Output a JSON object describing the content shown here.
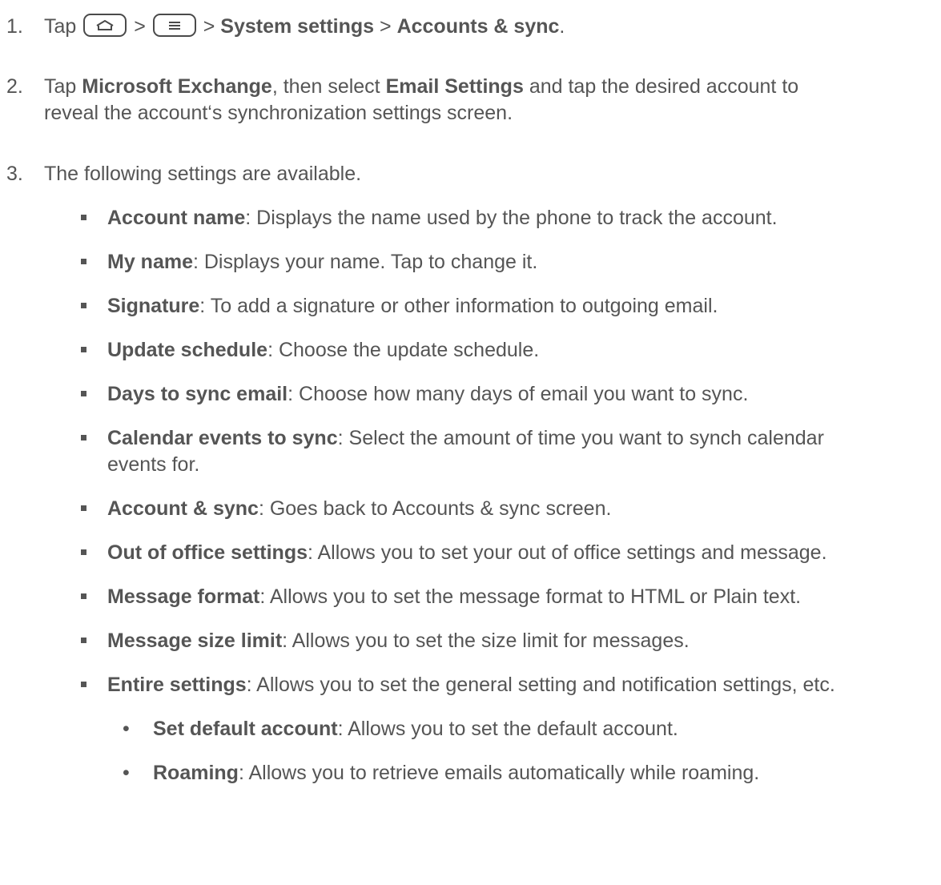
{
  "steps": [
    {
      "num": "1.",
      "tap": "Tap",
      "sep1": ">",
      "sep2": ">",
      "system_settings": "System settings",
      "sep3": ">",
      "accounts_sync": "Accounts & sync",
      "end": ".",
      "keys": [
        "home-icon",
        "menu-icon"
      ]
    },
    {
      "num": "2.",
      "tap": "Tap",
      "microsoft_exchange": "Microsoft Exchange",
      "then_select": ", then select",
      "email_settings": "Email Settings",
      "rest_line1": "and tap the desired account to",
      "line2": "reveal the account‘s synchronization settings screen."
    },
    {
      "num": "3.",
      "text": "The following settings are available."
    }
  ],
  "settings": [
    {
      "term": "Account name",
      "desc": ": Displays the name used by the phone to track the account."
    },
    {
      "term": "My name",
      "desc": ": Displays your name. Tap to change it."
    },
    {
      "term": "Signature",
      "desc": ": To add a signature or other information to outgoing email."
    },
    {
      "term": "Update schedule",
      "desc": ": Choose the update schedule."
    },
    {
      "term": "Days to sync email",
      "desc": ": Choose how many days of email you want to sync."
    },
    {
      "term": "Calendar events to sync",
      "desc": ": Select the amount of time you want to synch calendar",
      "desc2": "events for."
    },
    {
      "term": "Account & sync",
      "desc": ": Goes back to Accounts & sync screen."
    },
    {
      "term": "Out of office settings",
      "desc": ": Allows you to set your out of office settings and message."
    },
    {
      "term": "Message format",
      "desc": ": Allows you to set the message format to HTML or Plain text."
    },
    {
      "term": "Message size limit",
      "desc": ": Allows you to set the size limit for messages."
    },
    {
      "term": "Entire settings",
      "desc": ": Allows you to set the general setting and notification settings, etc."
    }
  ],
  "entire_settings_sub": [
    {
      "mark": "•",
      "term": "Set default account",
      "desc": ": Allows you to set the default account."
    },
    {
      "mark": "•",
      "term": "Roaming",
      "desc": ": Allows you to retrieve emails automatically while roaming."
    }
  ]
}
